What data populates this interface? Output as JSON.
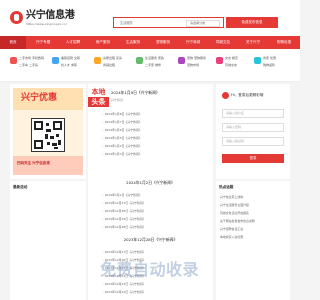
{
  "header": {
    "site_title": "兴宁信息港",
    "site_url": "https://www.xingningxx.cn/",
    "search_placeholder": "生活服务",
    "search_select": "请选择分类",
    "search_button": "免费发布信息"
  },
  "nav": {
    "items": [
      "首页",
      "兴宁专题",
      "人才招聘",
      "房产服务",
      "生活服务",
      "宠物服务",
      "兴宁商城",
      "同城交友",
      "关于兴宁",
      "购物优惠"
    ]
  },
  "categories": [
    {
      "line1": "二手市场  手机数码",
      "line2": "二手车  二手房",
      "color": "#ef5350"
    },
    {
      "line1": "兼职招聘  全职",
      "line2": "找人才  求职",
      "color": "#42a5f5"
    },
    {
      "line1": "房屋出租  买房",
      "line2": "商铺出租",
      "color": "#ffa726"
    },
    {
      "line1": "生活服务  家政",
      "line2": "二手家  维修",
      "color": "#66bb6a"
    },
    {
      "line1": "宠物  宠物服务",
      "line2": "宠物市场",
      "color": "#ab47bc"
    },
    {
      "line1": "交友  婚恋",
      "line2": "同城交友",
      "color": "#ec407a"
    },
    {
      "line1": "商家  优惠",
      "line2": "购物返利",
      "color": "#26c6da"
    }
  ],
  "poster": {
    "title": "兴宁优惠",
    "caption": "扫码关注  兴宁信息港"
  },
  "headline": {
    "badge_top": "本地",
    "badge_bottom": "头条",
    "sections": [
      {
        "title": "2024年1月9日《兴宁新闻》",
        "subtitle": "兴宁新闻",
        "items": [
          "2024年1月8日《兴宁新闻》",
          "2024年1月7日《兴宁新闻》",
          "2024年1月6日《兴宁新闻》",
          "2024年1月5日《兴宁新闻》",
          "2024年1月4日《兴宁新闻》",
          "2024年1月3日《兴宁新闻》"
        ]
      },
      {
        "title": "2024年1月2日《兴宁新闻》",
        "items": [
          "2024年1月1日《兴宁新闻》",
          "2023年12月31日《兴宁新闻》",
          "2023年12月30日《兴宁新闻》",
          "2023年12月29日《兴宁新闻》",
          "2023年12月28日《兴宁新闻》"
        ]
      },
      {
        "title": "2023年12月28日《兴宁新闻》",
        "items": [
          "2023年12月27日《兴宁新闻》",
          "2023年12月26日《兴宁新闻》",
          "2023年12月25日《兴宁新闻》",
          "2023年12月24日《兴宁新闻》",
          "2023年12月23日《兴宁新闻》",
          "2023年12月22日《兴宁新闻》"
        ]
      }
    ]
  },
  "login": {
    "greeting": "Hi，登录后更精彩哦",
    "username_placeholder": "请输入用户名",
    "password_placeholder": "请输入密码",
    "code_placeholder": "请输入验证码",
    "login_button": "登录"
  },
  "latest": {
    "title": "最新活动"
  },
  "notice": {
    "title": "热点话题",
    "items": [
      "兴宁信息港上线啦",
      "兴宁生活服务全面升级",
      "同城交友活动开启报名",
      "关于网站免费发布信息说明",
      "兴宁招聘信息汇总",
      "本地商家入驻优惠"
    ]
  },
  "watermark": "免费自动收录"
}
